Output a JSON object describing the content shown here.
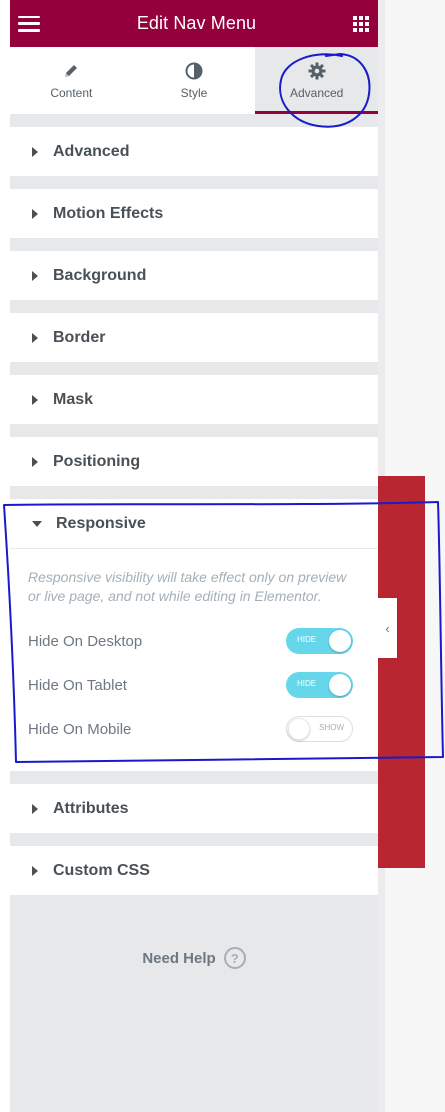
{
  "header": {
    "title": "Edit Nav Menu",
    "menu_icon": "hamburger-icon",
    "apps_icon": "grid-icon",
    "color": "#93003c"
  },
  "tabs": [
    {
      "label": "Content",
      "icon": "pencil-icon",
      "active": false
    },
    {
      "label": "Style",
      "icon": "half-circle-icon",
      "active": false
    },
    {
      "label": "Advanced",
      "icon": "gear-icon",
      "active": true
    }
  ],
  "sections": {
    "advanced": {
      "title": "Advanced"
    },
    "motion": {
      "title": "Motion Effects"
    },
    "background": {
      "title": "Background"
    },
    "border": {
      "title": "Border"
    },
    "mask": {
      "title": "Mask"
    },
    "positioning": {
      "title": "Positioning"
    },
    "responsive": {
      "title": "Responsive",
      "note": "Responsive visibility will take effect only on preview or live page, and not while editing in Elementor.",
      "controls": [
        {
          "label": "Hide On Desktop",
          "state": "HIDE",
          "on": true
        },
        {
          "label": "Hide On Tablet",
          "state": "HIDE",
          "on": true
        },
        {
          "label": "Hide On Mobile",
          "state": "SHOW",
          "on": false
        }
      ]
    },
    "attributes": {
      "title": "Attributes"
    },
    "custom_css": {
      "title": "Custom CSS"
    }
  },
  "help": {
    "label": "Need Help",
    "icon_glyph": "?"
  },
  "collapse": {
    "glyph": "‹"
  },
  "colors": {
    "accent": "#93003c",
    "toggle_on": "#66d7ea",
    "annotation": "#1a1acc",
    "preview_red": "#b82631"
  }
}
